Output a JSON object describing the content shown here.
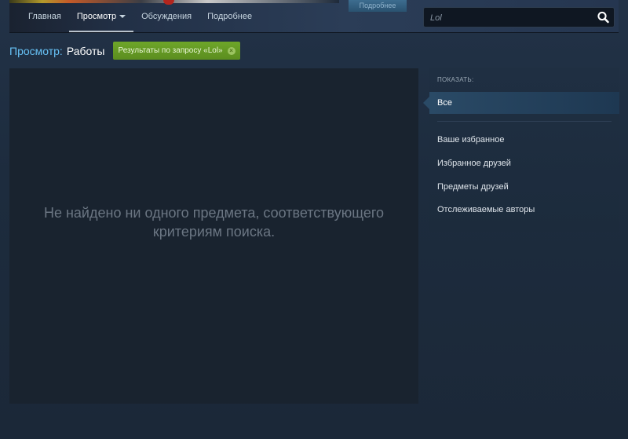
{
  "header": {
    "nav": [
      {
        "label": "Главная"
      },
      {
        "label": "Просмотр"
      },
      {
        "label": "Обсуждения"
      },
      {
        "label": "Подробнее"
      }
    ],
    "details_tab": "Подробнее",
    "search": {
      "value": "Lol"
    }
  },
  "breadcrumb": {
    "section": "Просмотр:",
    "page": "Работы"
  },
  "filter_tag": {
    "label": "Результаты по запросу «Lol»"
  },
  "results": {
    "empty_message": "Не найдено ни одного предмета, соответствующего критериям поиска."
  },
  "sidebar": {
    "heading": "ПОКАЗАТЬ:",
    "options": [
      {
        "label": "Все"
      },
      {
        "label": "Ваше избранное"
      },
      {
        "label": "Избранное друзей"
      },
      {
        "label": "Предметы друзей"
      },
      {
        "label": "Отслеживаемые авторы"
      }
    ]
  },
  "colors": {
    "background": "#1b2838",
    "link_accent": "#66c0f4",
    "tag_green": "#66991f",
    "panel": "#19232f"
  },
  "icons": [
    "search-icon",
    "remove-filter-icon",
    "dropdown-caret-icon"
  ]
}
